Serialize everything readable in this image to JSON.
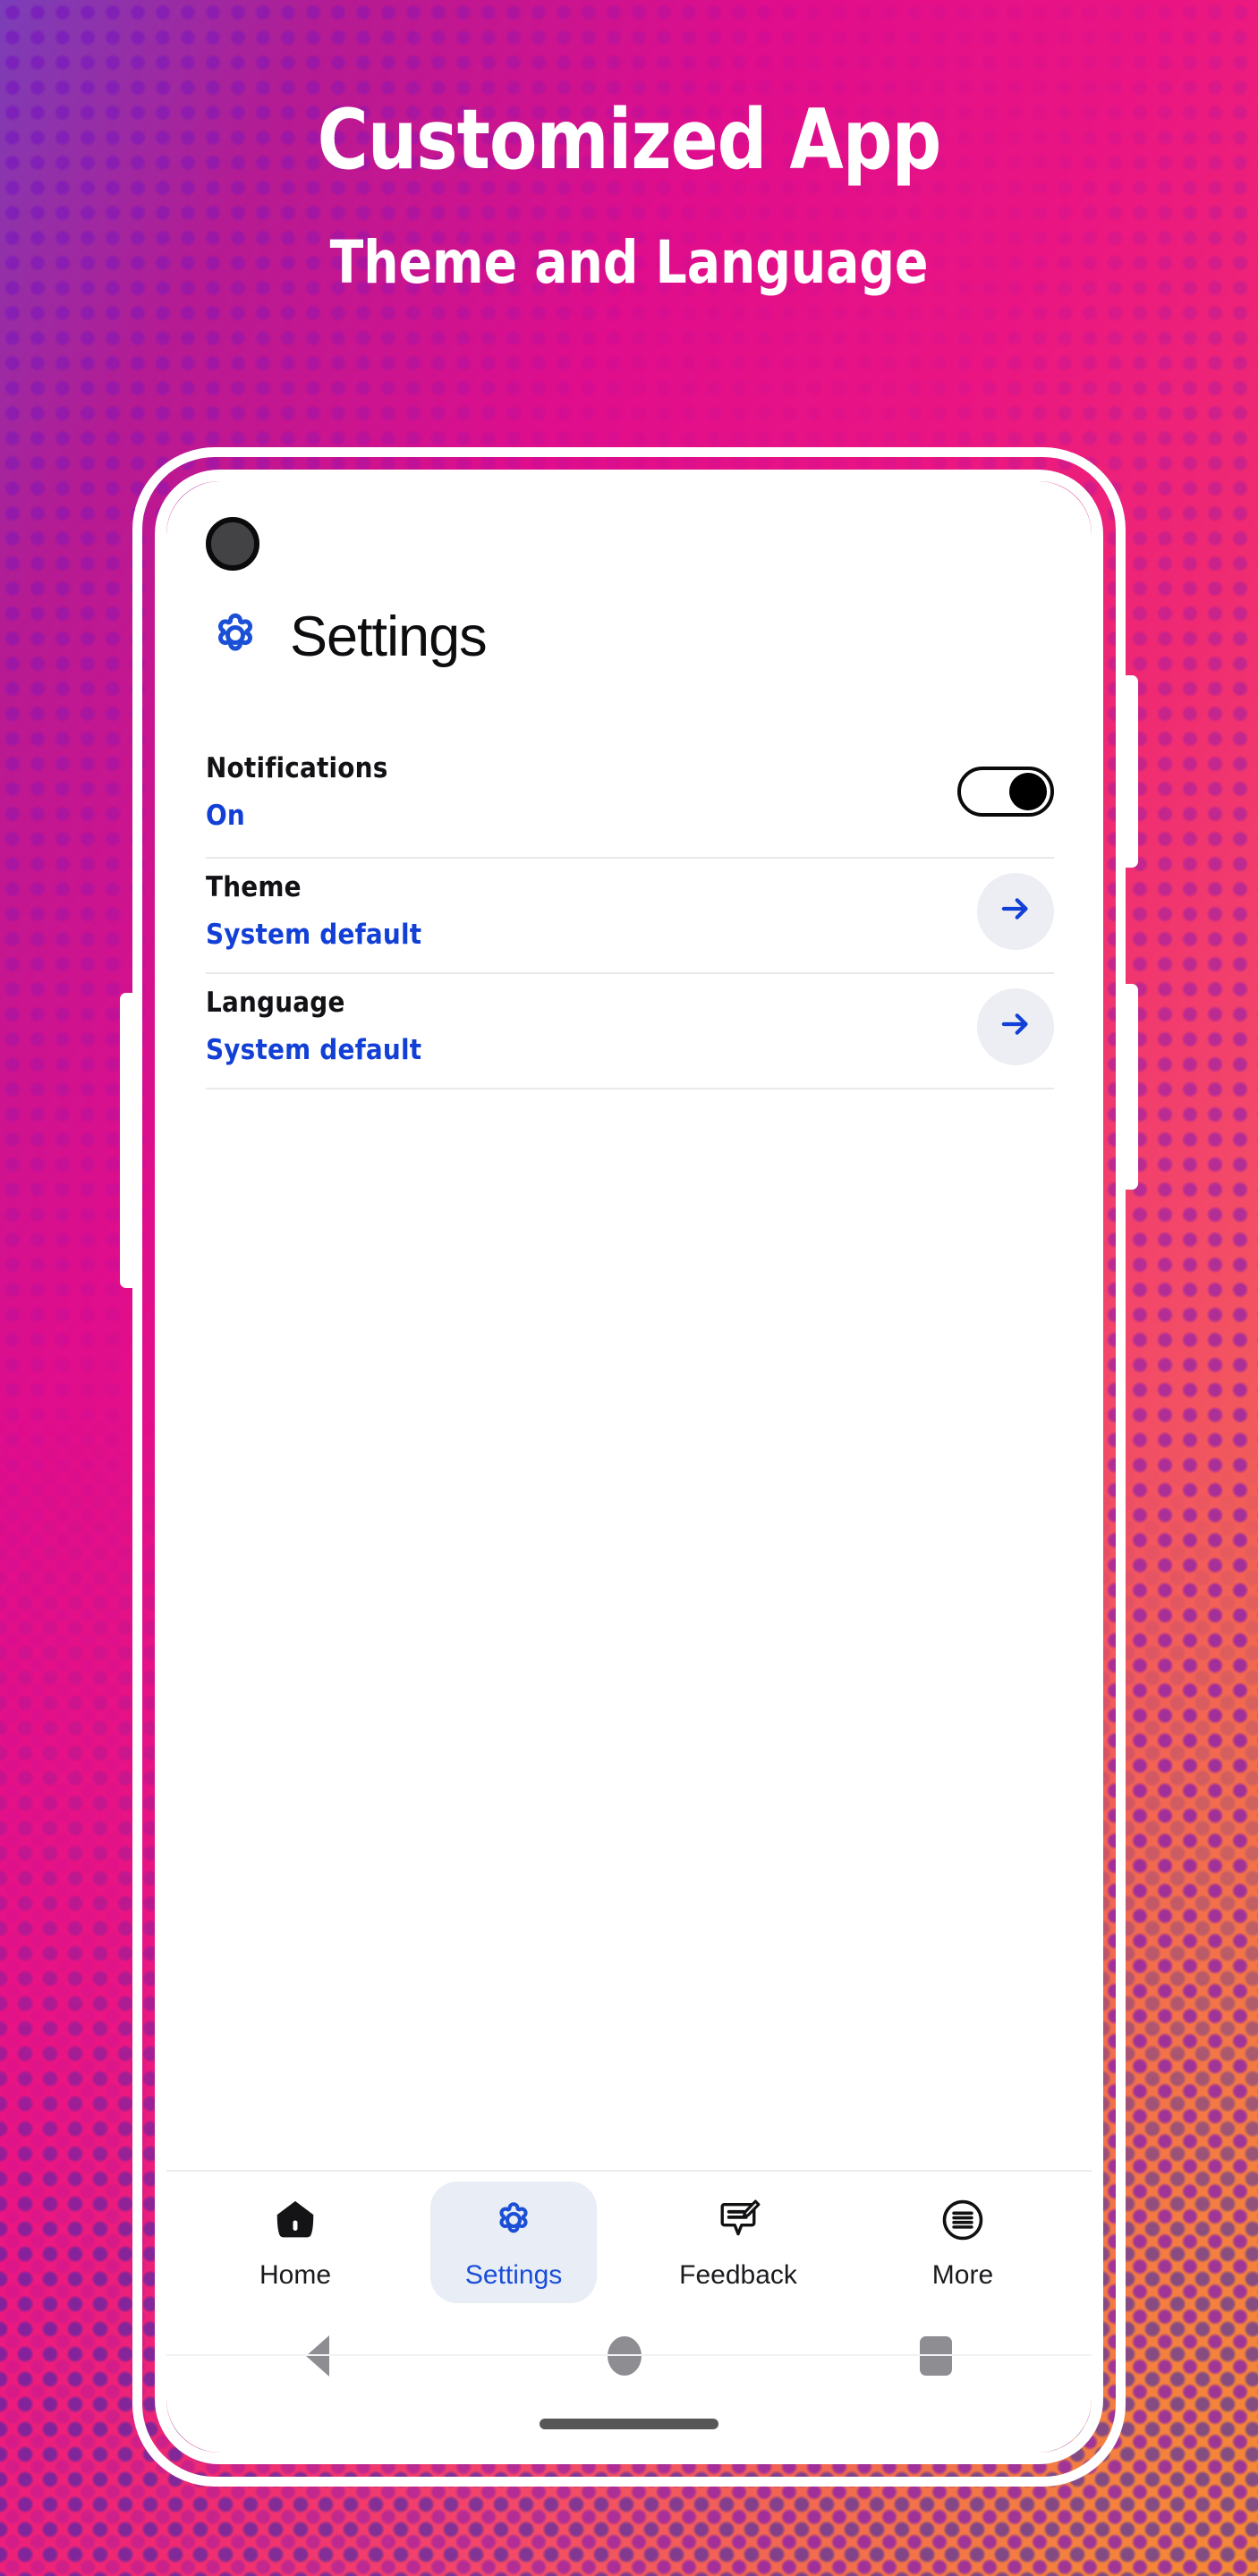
{
  "promo": {
    "title": "Customized App",
    "subtitle": "Theme and Language"
  },
  "colors": {
    "accent_blue": "#1240d6",
    "nav_active_blue": "#1a4ed8",
    "background_pink": "#e00d8c",
    "background_orange": "#f58a33",
    "arrow_button_bg": "#eceef4",
    "nav_active_pill_bg": "#e9edf5"
  },
  "app": {
    "header": {
      "icon": "gear-icon",
      "title": "Settings"
    },
    "settings": [
      {
        "title": "Notifications",
        "value": "On",
        "control": "toggle",
        "toggle_state": "on"
      },
      {
        "title": "Theme",
        "value": "System default",
        "control": "arrow",
        "arrow_icon": "arrow-right-icon"
      },
      {
        "title": "Language",
        "value": "System default",
        "control": "arrow",
        "arrow_icon": "arrow-right-icon"
      }
    ],
    "bottom_nav": [
      {
        "label": "Home",
        "icon": "home-icon",
        "active": false
      },
      {
        "label": "Settings",
        "icon": "gear-icon",
        "active": true
      },
      {
        "label": "Feedback",
        "icon": "feedback-icon",
        "active": false
      },
      {
        "label": "More",
        "icon": "more-circle-icon",
        "active": false
      }
    ],
    "system_nav": [
      {
        "icon": "back-triangle-icon"
      },
      {
        "icon": "home-circle-icon"
      },
      {
        "icon": "recents-square-icon"
      }
    ]
  },
  "device": {
    "camera": "front-camera-punchhole",
    "gesture_bar": "gesture-handle"
  }
}
